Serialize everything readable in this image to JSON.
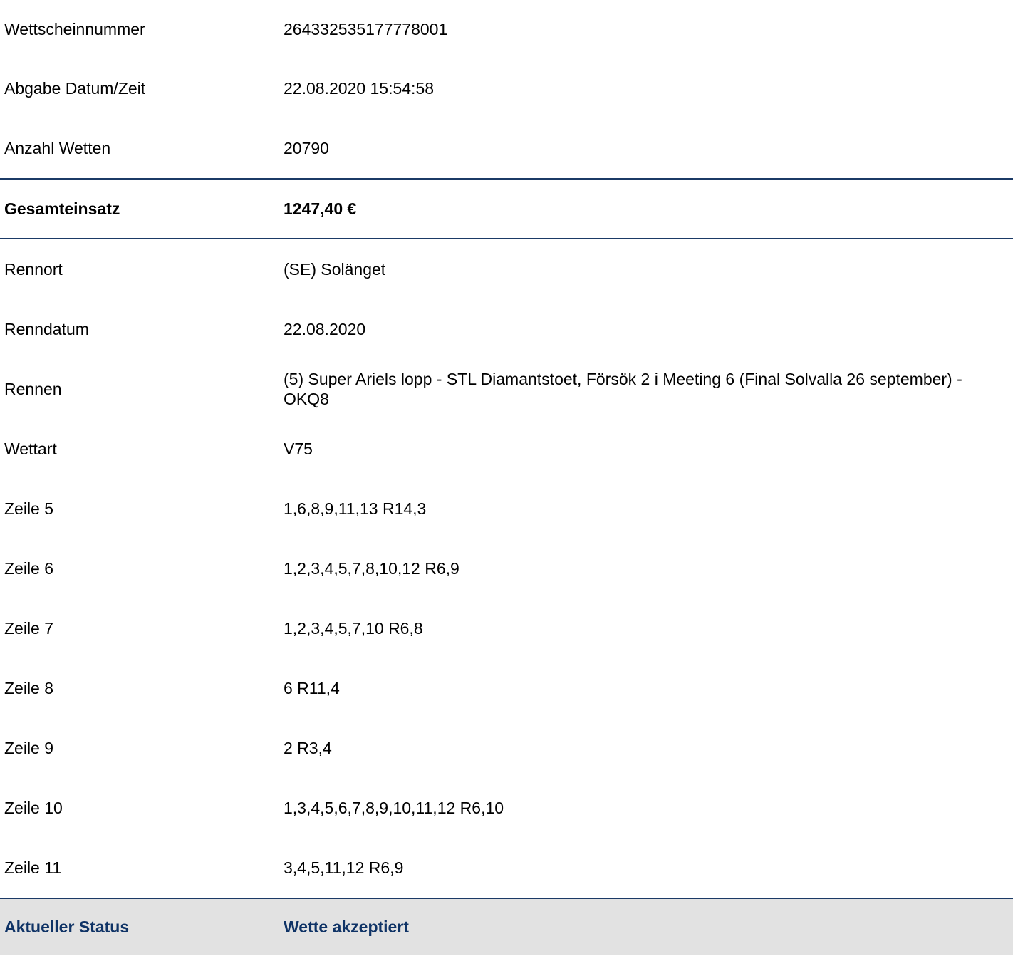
{
  "ticket": {
    "number_label": "Wettscheinnummer",
    "number_value": "264332535177778001",
    "datetime_label": "Abgabe Datum/Zeit",
    "datetime_value": "22.08.2020 15:54:58",
    "bets_label": "Anzahl Wetten",
    "bets_value": "20790"
  },
  "total": {
    "label": "Gesamteinsatz",
    "value": "1247,40 €"
  },
  "race": {
    "venue_label": "Rennort",
    "venue_value": "(SE) Solänget",
    "date_label": "Renndatum",
    "date_value": "22.08.2020",
    "race_label": "Rennen",
    "race_value": "(5) Super Ariels lopp - STL Diamantstoet, Försök 2 i Meeting 6 (Final Solvalla 26 september) - OKQ8",
    "type_label": "Wettart",
    "type_value": "V75"
  },
  "lines": [
    {
      "label": "Zeile 5",
      "value": "1,6,8,9,11,13 R14,3"
    },
    {
      "label": "Zeile 6",
      "value": "1,2,3,4,5,7,8,10,12 R6,9"
    },
    {
      "label": "Zeile 7",
      "value": "1,2,3,4,5,7,10 R6,8"
    },
    {
      "label": "Zeile 8",
      "value": "6 R11,4"
    },
    {
      "label": "Zeile 9",
      "value": "2 R3,4"
    },
    {
      "label": "Zeile 10",
      "value": "1,3,4,5,6,7,8,9,10,11,12 R6,10"
    },
    {
      "label": "Zeile 11",
      "value": "3,4,5,11,12 R6,9"
    }
  ],
  "status": {
    "label": "Aktueller Status",
    "value": "Wette akzeptiert",
    "color": "#0f3366"
  },
  "colors": {
    "divider": "#1b3a66",
    "status_background": "#e2e2e2"
  }
}
